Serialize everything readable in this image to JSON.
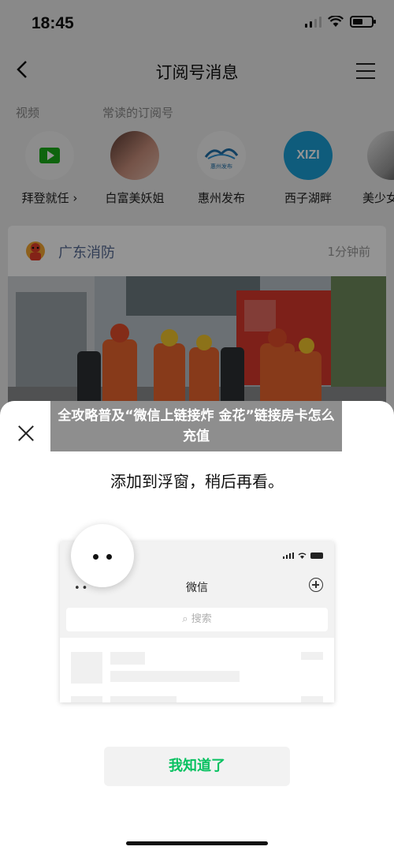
{
  "status_bar": {
    "time": "18:45"
  },
  "nav": {
    "back_icon": "chevron-left-icon",
    "title": "订阅号消息",
    "menu_icon": "menu-icon"
  },
  "sections": {
    "video_label": "视频",
    "frequent_label": "常读的订阅号"
  },
  "video_entry": {
    "name": "拜登就任 ›"
  },
  "subscriptions": [
    {
      "name": "白富美妖姐"
    },
    {
      "name": "惠州发布",
      "logo_text": "惠州发布"
    },
    {
      "name": "西子湖畔",
      "logo_text": "XIZI"
    },
    {
      "name": "美少女"
    }
  ],
  "card": {
    "account": "广东消防",
    "time": "1分钟前"
  },
  "sheet": {
    "close_icon": "close-icon",
    "title": "添加到浮窗，稍后再看。",
    "illustration": {
      "app_title": "微信",
      "search_placeholder": "搜索",
      "dots": "••"
    },
    "ok_label": "我知道了"
  },
  "overlay_caption": "全攻略普及“微信上链接炸 金花”链接房卡怎么充值",
  "colors": {
    "accent_green": "#07c160",
    "link_blue": "#576b95"
  }
}
